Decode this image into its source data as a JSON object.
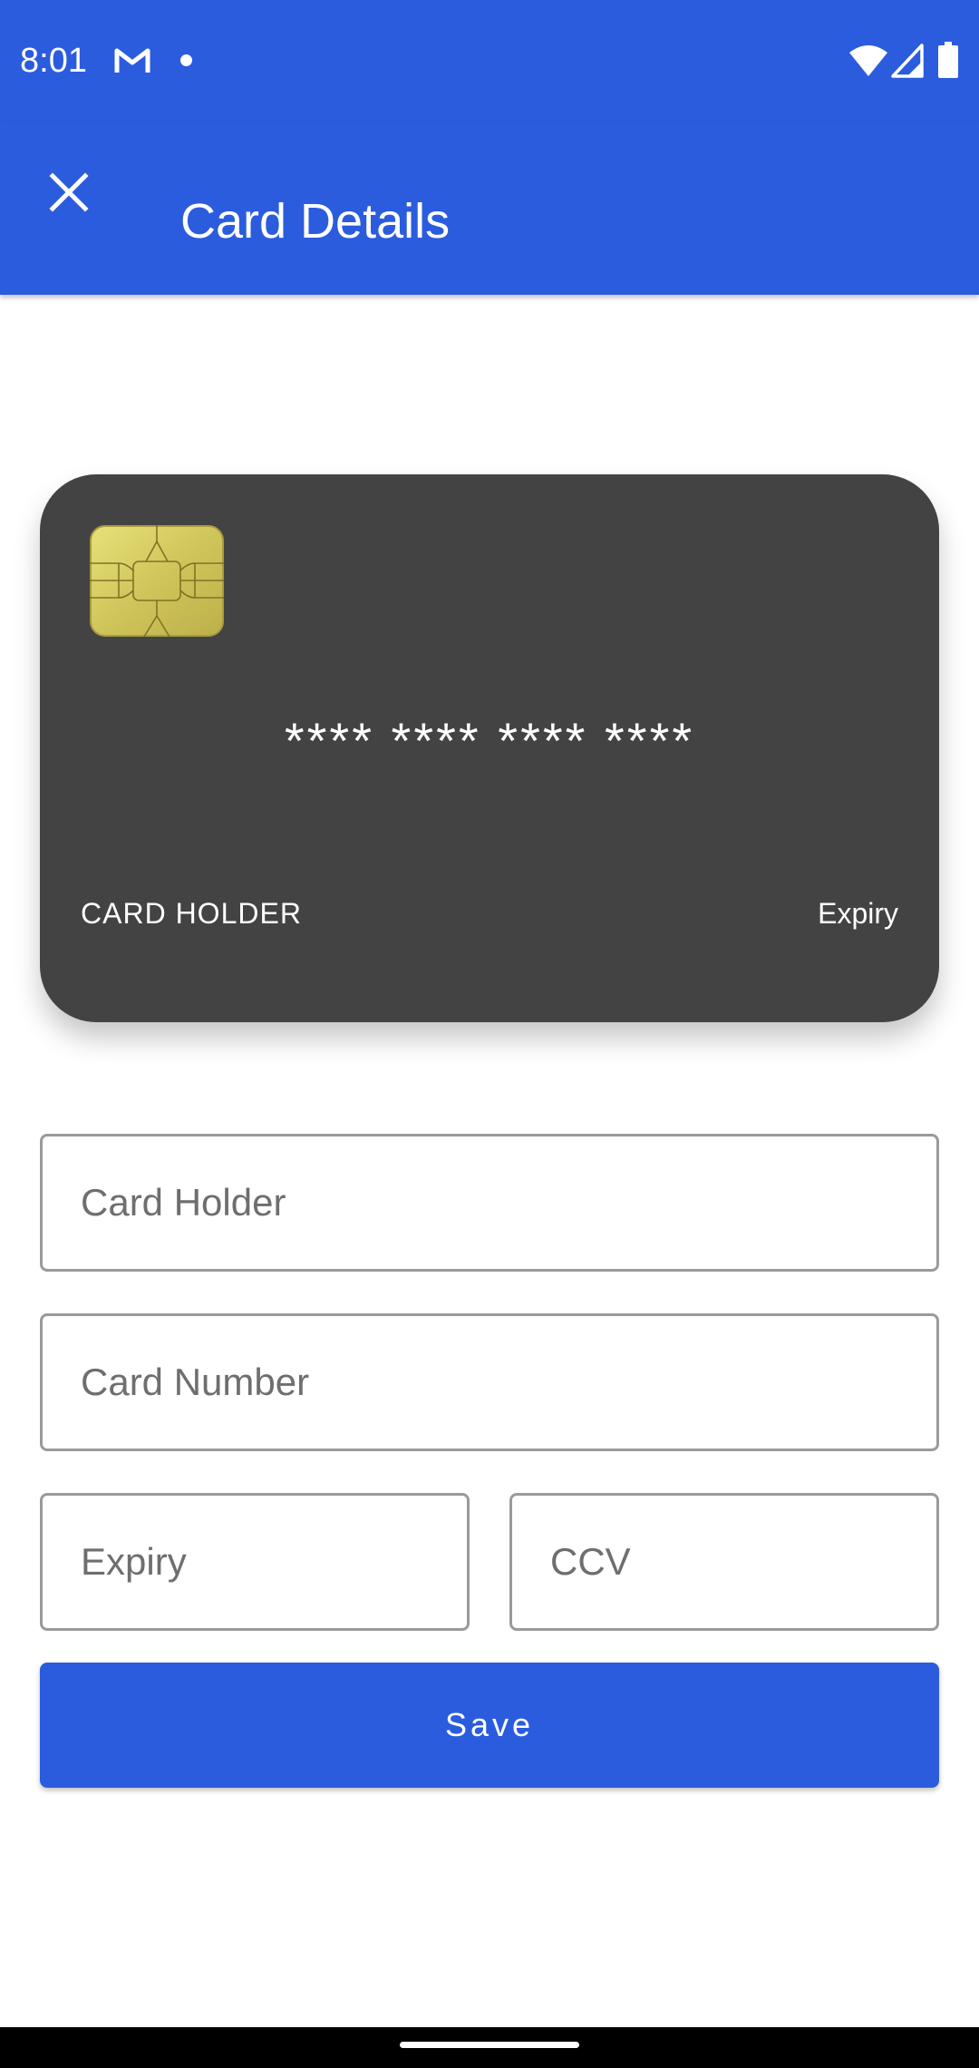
{
  "status_bar": {
    "time": "8:01",
    "icons": [
      "gmail-icon",
      "notification-dot-icon",
      "wifi-icon",
      "signal-icon",
      "battery-icon"
    ],
    "background": "#2b5cde"
  },
  "app_bar": {
    "title": "Card Details",
    "close_icon": "close-icon",
    "background": "#2b5cde"
  },
  "card_preview": {
    "number": "**** **** **** ****",
    "holder_label": "CARD HOLDER",
    "expiry_label": "Expiry",
    "background": "#434343",
    "chip_icon": "card-chip-icon"
  },
  "form": {
    "card_holder": {
      "placeholder": "Card Holder",
      "value": ""
    },
    "card_number": {
      "placeholder": "Card Number",
      "value": ""
    },
    "expiry": {
      "placeholder": "Expiry",
      "value": ""
    },
    "ccv": {
      "placeholder": "CCV",
      "value": ""
    },
    "save_label": "Save",
    "accent": "#2b5cde"
  },
  "nav_bar": {
    "home_indicator": "home-indicator"
  }
}
